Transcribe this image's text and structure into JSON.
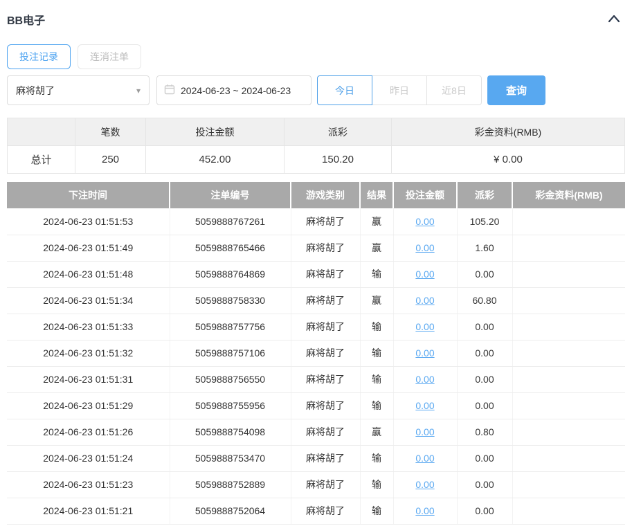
{
  "colors": {
    "accent_blue": "#4da3f0",
    "search_button_bg": "#58a8f0",
    "link_blue": "#5ba9f1",
    "table_header_bg": "#a9a9a9",
    "summary_header_bg": "#f0f0f0"
  },
  "header": {
    "title": "BB电子",
    "collapse_icon": "chevron-up"
  },
  "tabs": [
    {
      "label": "投注记录",
      "active": true
    },
    {
      "label": "连消注单",
      "active": false
    }
  ],
  "filters": {
    "game_select": {
      "value": "麻将胡了",
      "icon": "caret-down"
    },
    "date_range": {
      "value": "2024-06-23 ~ 2024-06-23",
      "icon": "calendar"
    },
    "quick_ranges": [
      {
        "label": "今日",
        "active": true
      },
      {
        "label": "昨日",
        "active": false
      },
      {
        "label": "近8日",
        "active": false
      }
    ],
    "search_label": "查询"
  },
  "summary": {
    "headers": [
      "",
      "笔数",
      "投注金额",
      "派彩",
      "彩金资料(RMB)"
    ],
    "row": {
      "label": "总计",
      "count": "250",
      "bet_amount": "452.00",
      "payout": "150.20",
      "bonus": "¥ 0.00"
    }
  },
  "table": {
    "headers": [
      "下注时间",
      "注单编号",
      "游戏类别",
      "结果",
      "投注金额",
      "派彩",
      "彩金资料(RMB)"
    ],
    "rows": [
      {
        "time": "2024-06-23 01:51:53",
        "order_no": "5059888767261",
        "game": "麻将胡了",
        "result": "赢",
        "bet_amount": "0.00",
        "payout": "105.20",
        "bonus": ""
      },
      {
        "time": "2024-06-23 01:51:49",
        "order_no": "5059888765466",
        "game": "麻将胡了",
        "result": "赢",
        "bet_amount": "0.00",
        "payout": "1.60",
        "bonus": ""
      },
      {
        "time": "2024-06-23 01:51:48",
        "order_no": "5059888764869",
        "game": "麻将胡了",
        "result": "输",
        "bet_amount": "0.00",
        "payout": "0.00",
        "bonus": ""
      },
      {
        "time": "2024-06-23 01:51:34",
        "order_no": "5059888758330",
        "game": "麻将胡了",
        "result": "赢",
        "bet_amount": "0.00",
        "payout": "60.80",
        "bonus": ""
      },
      {
        "time": "2024-06-23 01:51:33",
        "order_no": "5059888757756",
        "game": "麻将胡了",
        "result": "输",
        "bet_amount": "0.00",
        "payout": "0.00",
        "bonus": ""
      },
      {
        "time": "2024-06-23 01:51:32",
        "order_no": "5059888757106",
        "game": "麻将胡了",
        "result": "输",
        "bet_amount": "0.00",
        "payout": "0.00",
        "bonus": ""
      },
      {
        "time": "2024-06-23 01:51:31",
        "order_no": "5059888756550",
        "game": "麻将胡了",
        "result": "输",
        "bet_amount": "0.00",
        "payout": "0.00",
        "bonus": ""
      },
      {
        "time": "2024-06-23 01:51:29",
        "order_no": "5059888755956",
        "game": "麻将胡了",
        "result": "输",
        "bet_amount": "0.00",
        "payout": "0.00",
        "bonus": ""
      },
      {
        "time": "2024-06-23 01:51:26",
        "order_no": "5059888754098",
        "game": "麻将胡了",
        "result": "赢",
        "bet_amount": "0.00",
        "payout": "0.80",
        "bonus": ""
      },
      {
        "time": "2024-06-23 01:51:24",
        "order_no": "5059888753470",
        "game": "麻将胡了",
        "result": "输",
        "bet_amount": "0.00",
        "payout": "0.00",
        "bonus": ""
      },
      {
        "time": "2024-06-23 01:51:23",
        "order_no": "5059888752889",
        "game": "麻将胡了",
        "result": "输",
        "bet_amount": "0.00",
        "payout": "0.00",
        "bonus": ""
      },
      {
        "time": "2024-06-23 01:51:21",
        "order_no": "5059888752064",
        "game": "麻将胡了",
        "result": "输",
        "bet_amount": "0.00",
        "payout": "0.00",
        "bonus": ""
      }
    ]
  }
}
